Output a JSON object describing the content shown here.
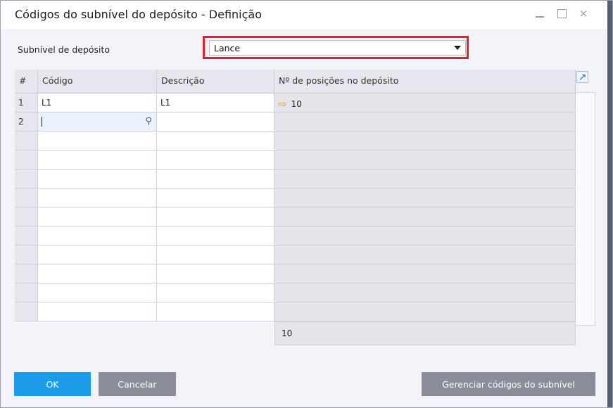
{
  "window": {
    "title": "Códigos do subnível do depósito - Definição",
    "controls": {
      "minimize": "_",
      "maximize": "□",
      "close": "×"
    }
  },
  "filter": {
    "label": "Subnível de depósito",
    "selected_value": "Lance"
  },
  "table": {
    "columns": [
      "#",
      "Código",
      "Descrição",
      "Nº de posições no depósito"
    ],
    "rows": [
      {
        "num": "1",
        "codigo": "L1",
        "descricao": "L1",
        "posicoes": "10"
      },
      {
        "num": "2",
        "codigo": "",
        "descricao": "",
        "posicoes": ""
      }
    ],
    "total_posicoes": "10"
  },
  "buttons": {
    "ok": "OK",
    "cancel": "Cancelar",
    "manage": "Gerenciar códigos do subnível"
  },
  "icons": {
    "expand": "expand-arrow-icon",
    "lookup": "lookup-icon",
    "link_arrow": "link-arrow-icon"
  },
  "colors": {
    "ok_button": "#1c9ce8",
    "secondary_button": "#8a8d99",
    "highlight_border": "#e0202a",
    "link_arrow": "#e8a317"
  }
}
